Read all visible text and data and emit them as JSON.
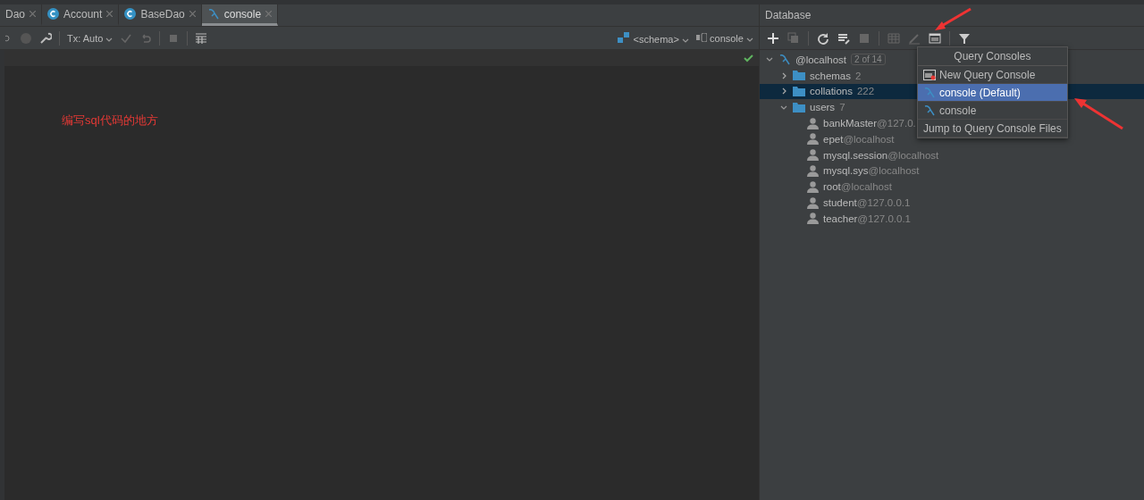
{
  "editor_tabs": [
    {
      "label": "Dao",
      "kind": "cut",
      "selected": false
    },
    {
      "label": "Account",
      "kind": "class",
      "selected": false
    },
    {
      "label": "BaseDao",
      "kind": "class",
      "selected": false
    },
    {
      "label": "console",
      "kind": "console",
      "selected": true
    }
  ],
  "editor_toolbar": {
    "tx_mode": "Tx: Auto",
    "schema": "<schema>",
    "session": "console"
  },
  "editor": {
    "annotation": "编写sql代码的地方"
  },
  "database_panel": {
    "title": "Database",
    "tree": [
      {
        "label": "@localhost",
        "kind": "host",
        "count": "2 of 14",
        "expanded": true,
        "selected": false,
        "children": [
          {
            "label": "schemas",
            "kind": "folder",
            "count": "2",
            "expanded": false,
            "selected": false
          },
          {
            "label": "collations",
            "kind": "folder",
            "count": "222",
            "expanded": false,
            "selected": true
          },
          {
            "label": "users",
            "kind": "folder",
            "count": "7",
            "expanded": true,
            "selected": false,
            "children": [
              {
                "label": "bankMaster",
                "kind": "user",
                "host": "@127.0.",
                "selected": false
              },
              {
                "label": "epet",
                "kind": "user",
                "host": "@localhost",
                "selected": false
              },
              {
                "label": "mysql.session",
                "kind": "user",
                "host": "@localhost",
                "selected": false
              },
              {
                "label": "mysql.sys",
                "kind": "user",
                "host": "@localhost",
                "selected": false
              },
              {
                "label": "root",
                "kind": "user",
                "host": "@localhost",
                "selected": false
              },
              {
                "label": "student",
                "kind": "user",
                "host": "@127.0.0.1",
                "selected": false
              },
              {
                "label": "teacher",
                "kind": "user",
                "host": "@127.0.0.1",
                "selected": false
              }
            ]
          }
        ]
      }
    ]
  },
  "query_consoles_menu": {
    "title": "Query Consoles",
    "items": [
      {
        "label": "New Query Console",
        "kind": "new",
        "selected": false
      },
      {
        "label": "console (Default)",
        "kind": "console",
        "selected": true
      },
      {
        "label": "console",
        "kind": "console",
        "selected": false
      },
      {
        "label": "Jump to Query Console Files",
        "kind": "plain",
        "selected": false
      }
    ]
  }
}
